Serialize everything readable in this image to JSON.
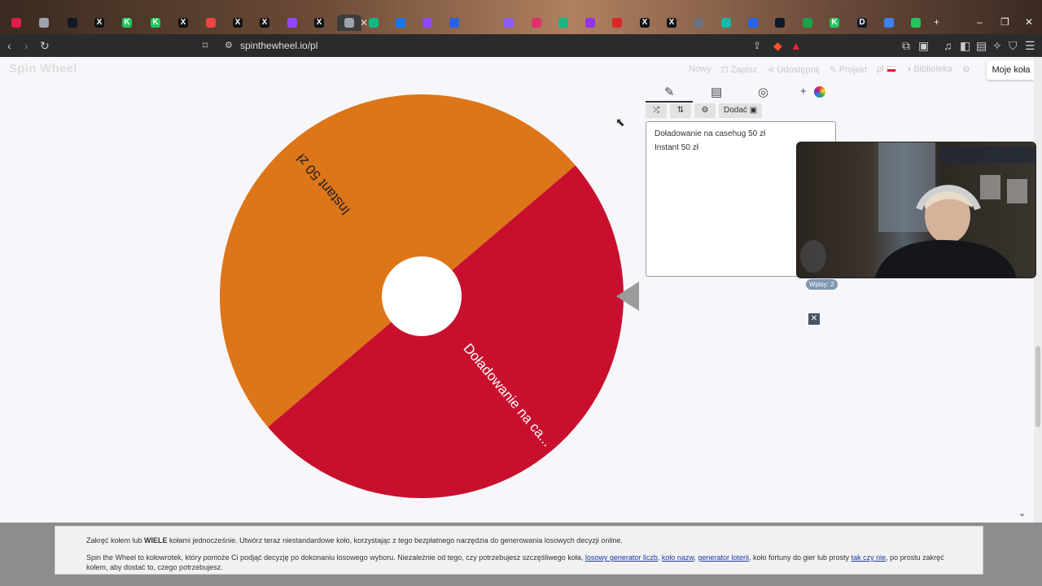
{
  "browser": {
    "url": "spinthewheel.io/pl",
    "tabs": [
      {
        "icon": "tab-favicon-circle-red",
        "color": "#e11d48"
      },
      {
        "icon": "tab-favicon-globe",
        "color": "#9ca3af"
      },
      {
        "icon": "tab-favicon-chat",
        "color": "#111827"
      },
      {
        "icon": "tab-favicon-x",
        "color": "#111111"
      },
      {
        "icon": "tab-favicon-k",
        "color": "#22c55e"
      },
      {
        "icon": "tab-favicon-k",
        "color": "#22c55e"
      },
      {
        "icon": "tab-favicon-x",
        "color": "#111111"
      },
      {
        "icon": "tab-favicon-youtube",
        "color": "#ef4444"
      },
      {
        "icon": "tab-favicon-x",
        "color": "#111111"
      },
      {
        "icon": "tab-favicon-x",
        "color": "#111111"
      },
      {
        "icon": "tab-favicon-twitch",
        "color": "#9146ff"
      },
      {
        "icon": "tab-favicon-x",
        "color": "#111111"
      },
      {
        "icon": "tab-favicon-active-page",
        "color": "#9ca3af"
      },
      {
        "icon": "tab-favicon-green",
        "color": "#10b981"
      },
      {
        "icon": "tab-favicon-facebook",
        "color": "#1877f2"
      },
      {
        "icon": "tab-favicon-twitch",
        "color": "#9146ff"
      },
      {
        "icon": "tab-favicon-blue",
        "color": "#2563eb"
      },
      {
        "icon": "tab-favicon-feather",
        "color": "#8b5cf6"
      },
      {
        "icon": "tab-favicon-instagram",
        "color": "#e1306c"
      },
      {
        "icon": "tab-favicon-green",
        "color": "#10b981"
      },
      {
        "icon": "tab-favicon-purple",
        "color": "#9333ea"
      },
      {
        "icon": "tab-favicon-red",
        "color": "#dc2626"
      },
      {
        "icon": "tab-favicon-x",
        "color": "#111111"
      },
      {
        "icon": "tab-favicon-x",
        "color": "#111111"
      },
      {
        "icon": "tab-favicon-gray",
        "color": "#6b7280"
      },
      {
        "icon": "tab-favicon-teal",
        "color": "#14b8a6"
      },
      {
        "icon": "tab-favicon-blue",
        "color": "#2563eb"
      },
      {
        "icon": "tab-favicon-dark",
        "color": "#111827"
      },
      {
        "icon": "tab-favicon-green",
        "color": "#16a34a"
      },
      {
        "icon": "tab-favicon-k",
        "color": "#22c55e"
      },
      {
        "icon": "tab-favicon-d",
        "color": "#111827"
      },
      {
        "icon": "tab-favicon-blue",
        "color": "#3b82f6"
      },
      {
        "icon": "tab-favicon-maps",
        "color": "#22c55e"
      }
    ],
    "tab_close_glyph": "✕",
    "tab_letters": {
      "x": "X",
      "k": "K",
      "d": "D"
    },
    "new_tab_glyph": "+",
    "window_controls": [
      "–",
      "❐",
      "✕"
    ]
  },
  "site": {
    "logo": "Spin Wheel",
    "menu": {
      "new": "Nowy",
      "save": "Zapisz",
      "share": "Udostępnij",
      "project": "Projekt",
      "lang": "pl",
      "library": "Biblioteka",
      "my_wheels": "Moje koła"
    }
  },
  "wheel": {
    "segments": [
      {
        "label": "Instant 50 zł",
        "color": "#dd7519"
      },
      {
        "label": "Doładowanie na ca...",
        "color": "#c8102e"
      }
    ]
  },
  "panel": {
    "add_button": "Dodać",
    "add_glyph": "+",
    "entries": [
      "Doładowanie na casehug 50 zł",
      "Instant 50 zł"
    ],
    "entries_count": "Wpisy: 2",
    "close_glyph": "✕"
  },
  "info": {
    "p1_a": "Zakręć kołem lub ",
    "p1_bold": "WIELE",
    "p1_b": " kołami jednocześnie. Utwórz teraz niestandardowe koło, korzystając z tego bezpłatnego narzędzia do generowania losowych decyzji online.",
    "p2_a": "Spin the Wheel to kołowrotek, który pomoże Ci podjąć decyzję po dokonaniu losowego wyboru. Niezależnie od tego, czy potrzebujesz szczęśliwego koła, ",
    "link1": "losowy generator liczb",
    "sep1": ", ",
    "link2": "koło nazw",
    "sep2": ", ",
    "link3": "generator loterii",
    "p2_b": ", koło fortuny do gier lub prosty ",
    "link4": "tak czy nie",
    "p2_c": ", po prostu zakręć kołem, aby dostać to, czego potrzebujesz."
  }
}
